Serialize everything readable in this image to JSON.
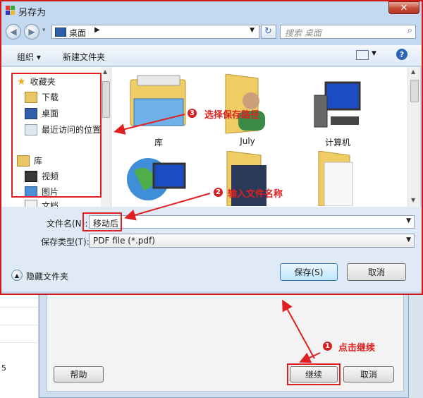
{
  "window": {
    "title": "另存为",
    "close_label": "✕"
  },
  "address": {
    "location": "桌面",
    "search_placeholder": "搜索 桌面"
  },
  "toolbar": {
    "organize": "组织 ▾",
    "new_folder": "新建文件夹"
  },
  "nav": {
    "favorites": "收藏夹",
    "items": [
      "下载",
      "桌面",
      "最近访问的位置"
    ],
    "libraries": "库",
    "lib_items": [
      "视频",
      "图片",
      "文档"
    ]
  },
  "content": {
    "items": [
      "库",
      "July",
      "计算机",
      "",
      "",
      ""
    ]
  },
  "form": {
    "filename_label": "文件名(N):",
    "filename_value": "移动后",
    "filetype_label": "保存类型(T):",
    "filetype_value": "PDF file (*.pdf)",
    "hide_folders": "隐藏文件夹",
    "save": "保存(S)",
    "cancel": "取消"
  },
  "background_dialog": {
    "help": "帮助",
    "continue": "继续",
    "cancel": "取消"
  },
  "annotations": {
    "step1": {
      "num": "1",
      "text": "点击继续"
    },
    "step2": {
      "num": "2",
      "text": "输入文件名称"
    },
    "step3": {
      "num": "3",
      "text": "选择保存路径"
    }
  },
  "leftstrip_text": "5",
  "colors": {
    "annotation": "#e02020",
    "window_frame": "#c4d8ef"
  }
}
